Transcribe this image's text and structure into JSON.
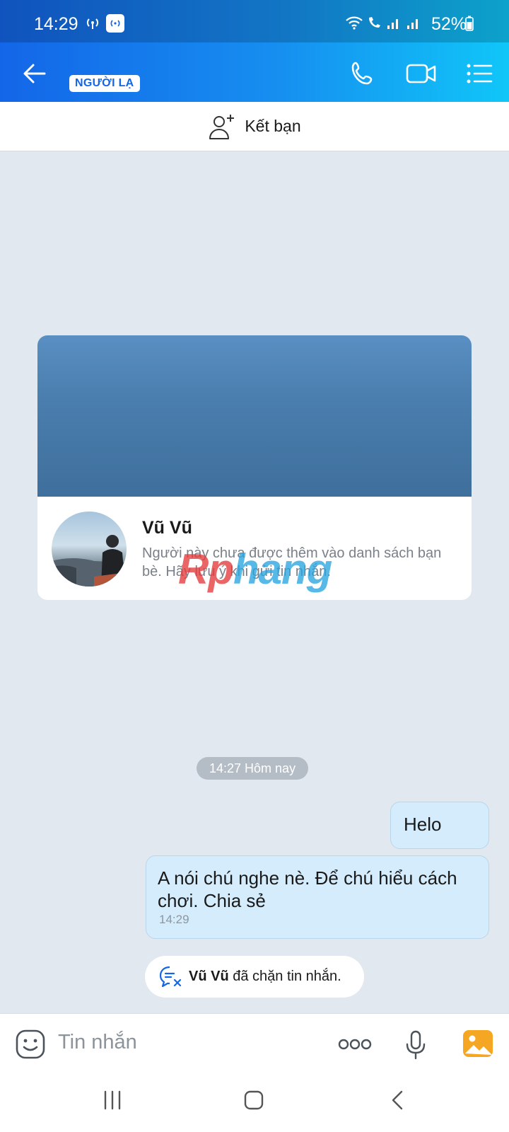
{
  "status_bar": {
    "time": "14:29",
    "battery": "52%"
  },
  "header": {
    "badge": "NGƯỜI LẠ",
    "icons": [
      "back-arrow-icon",
      "phone-icon",
      "video-call-icon",
      "menu-list-icon"
    ]
  },
  "friend_bar": {
    "label": "Kết bạn",
    "icon": "add-user-icon"
  },
  "profile_card": {
    "name": "Vũ Vũ",
    "notice": "Người này chưa được thêm vào danh sách bạn bè. Hãy lưu ý khi gửi tin nhắn."
  },
  "watermark": {
    "part1": "Rp",
    "part2": "hang"
  },
  "timestamp_chip": "14:27 Hôm nay",
  "messages": [
    {
      "text": "Helo"
    },
    {
      "text": "A nói chú nghe nè. Để chú hiểu cách chơi. Chia sẻ",
      "time": "14:29"
    }
  ],
  "blocked_notice": {
    "name": "Vũ Vũ",
    "text": " đã chặn tin nhắn."
  },
  "input": {
    "placeholder": "Tin nhắn"
  },
  "colors": {
    "accent": "#1466e8",
    "bubble": "#d4ecfb",
    "background": "#e2e8ef"
  }
}
